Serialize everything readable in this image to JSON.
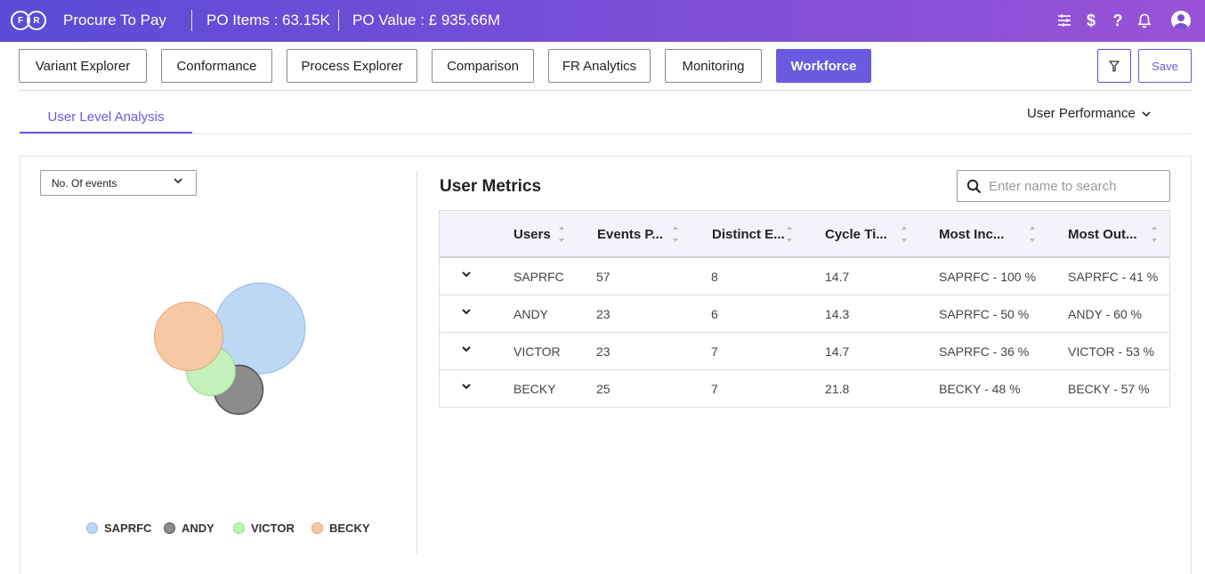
{
  "header": {
    "logo_text": [
      "F",
      "R"
    ],
    "app_title": "Procure To Pay",
    "po_items": "PO Items : 63.15K",
    "po_value": "PO Value : £ 935.66M",
    "icons": [
      "sliders-icon",
      "dollar-icon",
      "help-icon",
      "bell-icon",
      "user-avatar-icon"
    ]
  },
  "nav": {
    "tabs": [
      "Variant Explorer",
      "Conformance",
      "Process Explorer",
      "Comparison",
      "FR Analytics",
      "Monitoring",
      "Workforce"
    ],
    "active_tab": "Workforce",
    "save_label": "Save"
  },
  "subnav": {
    "active_tab": "User Level Analysis",
    "dropdown_label": "User Performance"
  },
  "left_panel": {
    "metric_select": "No. Of events",
    "legend": [
      "SAPRFC",
      "ANDY",
      "VICTOR",
      "BECKY"
    ],
    "colors": {
      "SAPRFC": "#bcd8f5",
      "ANDY": "#8c8c8c",
      "VICTOR": "#c4f0bc",
      "BECKY": "#f7c8a4"
    }
  },
  "chart_data": {
    "type": "bubble",
    "metric": "No. Of events",
    "series": [
      {
        "name": "SAPRFC",
        "value": 57
      },
      {
        "name": "ANDY",
        "value": 23
      },
      {
        "name": "VICTOR",
        "value": 23
      },
      {
        "name": "BECKY",
        "value": 25
      }
    ],
    "legend_position": "bottom"
  },
  "user_metrics": {
    "title": "User Metrics",
    "search_placeholder": "Enter name to search",
    "columns": [
      "Users",
      "Events P...",
      "Distinct E...",
      "Cycle Ti...",
      "Most Inc...",
      "Most Out..."
    ],
    "rows": [
      [
        "SAPRFC",
        "57",
        "8",
        "14.7",
        "SAPRFC - 100 %",
        "SAPRFC - 41 %"
      ],
      [
        "ANDY",
        "23",
        "6",
        "14.3",
        "SAPRFC - 50 %",
        "ANDY - 60 %"
      ],
      [
        "VICTOR",
        "23",
        "7",
        "14.7",
        "SAPRFC - 36 %",
        "VICTOR - 53 %"
      ],
      [
        "BECKY",
        "25",
        "7",
        "21.8",
        "BECKY - 48 %",
        "BECKY - 57 %"
      ]
    ]
  }
}
